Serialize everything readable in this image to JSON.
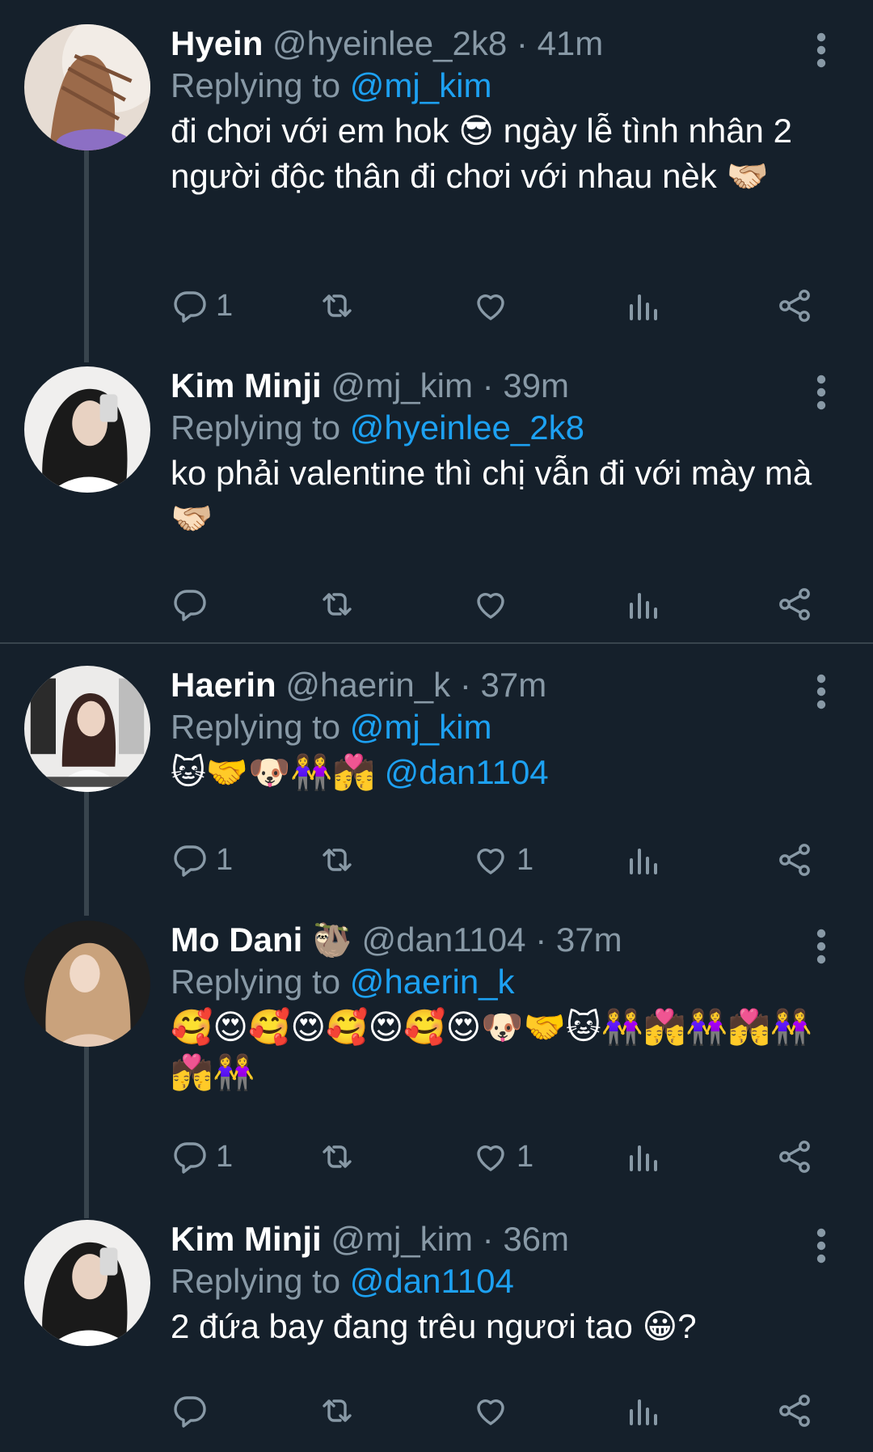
{
  "tweets": [
    {
      "name": "Hyein",
      "handle": "@hyeinlee_2k8",
      "time": "41m",
      "replying_label": "Replying to",
      "replying_to": "@mj_kim",
      "text": "đi chơi với em hok 😎 ngày lễ tình nhân 2 người độc thân đi chơi với nhau nèk 🫱🏻‍🫲🏼",
      "reply_count": "1",
      "like_count": ""
    },
    {
      "name": "Kim Minji",
      "handle": "@mj_kim",
      "time": "39m",
      "replying_label": "Replying to",
      "replying_to": "@hyeinlee_2k8",
      "text": "ko phải valentine thì chị vẫn đi với mày mà 🫱🏻‍🫲🏼",
      "reply_count": "",
      "like_count": ""
    },
    {
      "name": "Haerin",
      "handle": "@haerin_k",
      "time": "37m",
      "replying_label": "Replying to",
      "replying_to": "@mj_kim",
      "text_emoji": "🐱🤝🐶👭💏",
      "text_mention": "@dan1104",
      "reply_count": "1",
      "like_count": "1"
    },
    {
      "name": "Mo Dani",
      "name_emoji": "🦥",
      "handle": "@dan1104",
      "time": "37m",
      "replying_label": "Replying to",
      "replying_to": "@haerin_k",
      "text": "🥰😍🥰😍🥰😍🥰😍🐶🤝🐱👭💏👭💏👭💏👭",
      "reply_count": "1",
      "like_count": "1"
    },
    {
      "name": "Kim Minji",
      "handle": "@mj_kim",
      "time": "36m",
      "replying_label": "Replying to",
      "replying_to": "@dan1104",
      "text": "2 đứa bay đang trêu ngươi tao 😀?",
      "reply_count": "",
      "like_count": ""
    }
  ],
  "separator": "·",
  "icons": [
    "reply-icon",
    "retweet-icon",
    "like-icon",
    "analytics-icon",
    "share-icon",
    "more-icon"
  ]
}
